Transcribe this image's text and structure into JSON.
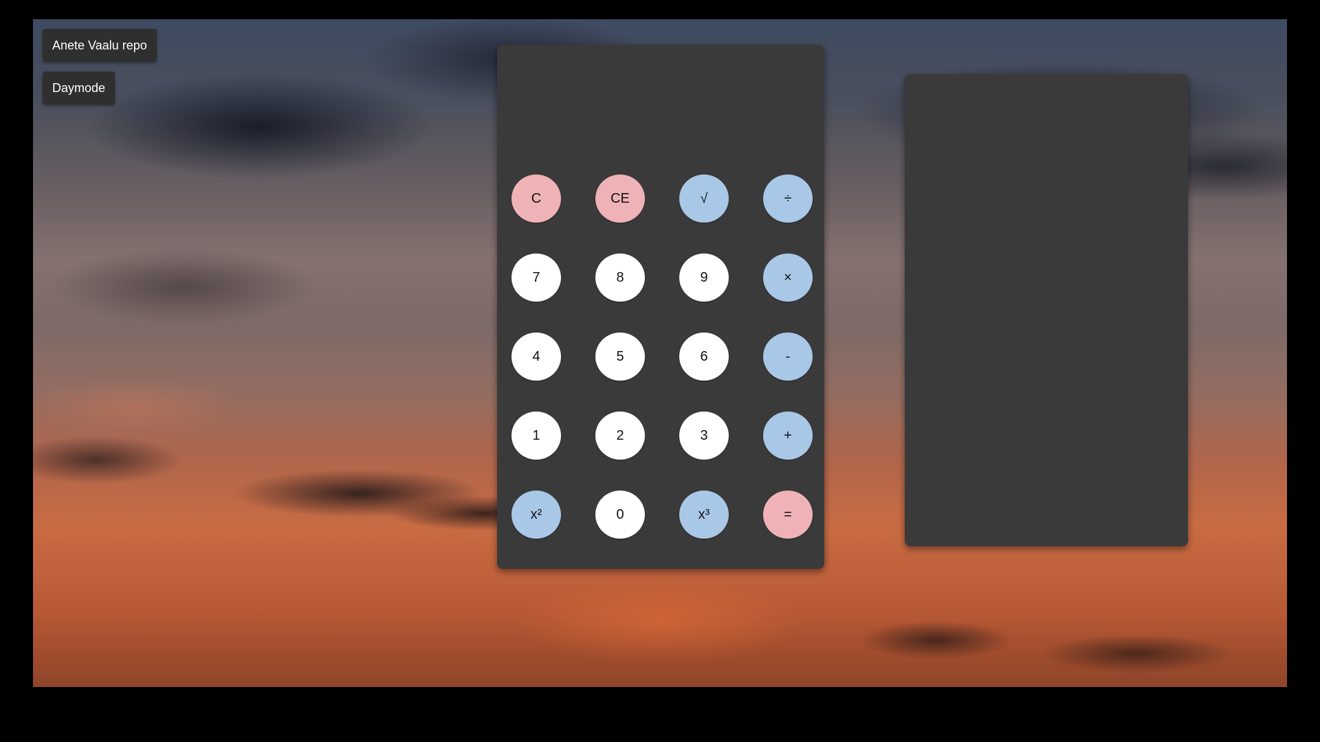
{
  "top_buttons": {
    "repo_label": "Anete Vaalu repo",
    "mode_label": "Daymode"
  },
  "calculator": {
    "display_value": "",
    "keys": [
      {
        "label": "C",
        "kind": "clear"
      },
      {
        "label": "CE",
        "kind": "clear"
      },
      {
        "label": "√",
        "kind": "op"
      },
      {
        "label": "÷",
        "kind": "op"
      },
      {
        "label": "7",
        "kind": "num"
      },
      {
        "label": "8",
        "kind": "num"
      },
      {
        "label": "9",
        "kind": "num"
      },
      {
        "label": "×",
        "kind": "op"
      },
      {
        "label": "4",
        "kind": "num"
      },
      {
        "label": "5",
        "kind": "num"
      },
      {
        "label": "6",
        "kind": "num"
      },
      {
        "label": "-",
        "kind": "op"
      },
      {
        "label": "1",
        "kind": "num"
      },
      {
        "label": "2",
        "kind": "num"
      },
      {
        "label": "3",
        "kind": "num"
      },
      {
        "label": "+",
        "kind": "op"
      },
      {
        "label": "x²",
        "kind": "op"
      },
      {
        "label": "0",
        "kind": "num"
      },
      {
        "label": "x³",
        "kind": "op"
      },
      {
        "label": "=",
        "kind": "clear"
      }
    ]
  },
  "history": {
    "entries": []
  },
  "colors": {
    "panel": "#3a3a3a",
    "number_key": "#ffffff",
    "operator_key": "#a9c8e8",
    "clear_key": "#efb3b7",
    "button": "#2f2f2f"
  }
}
